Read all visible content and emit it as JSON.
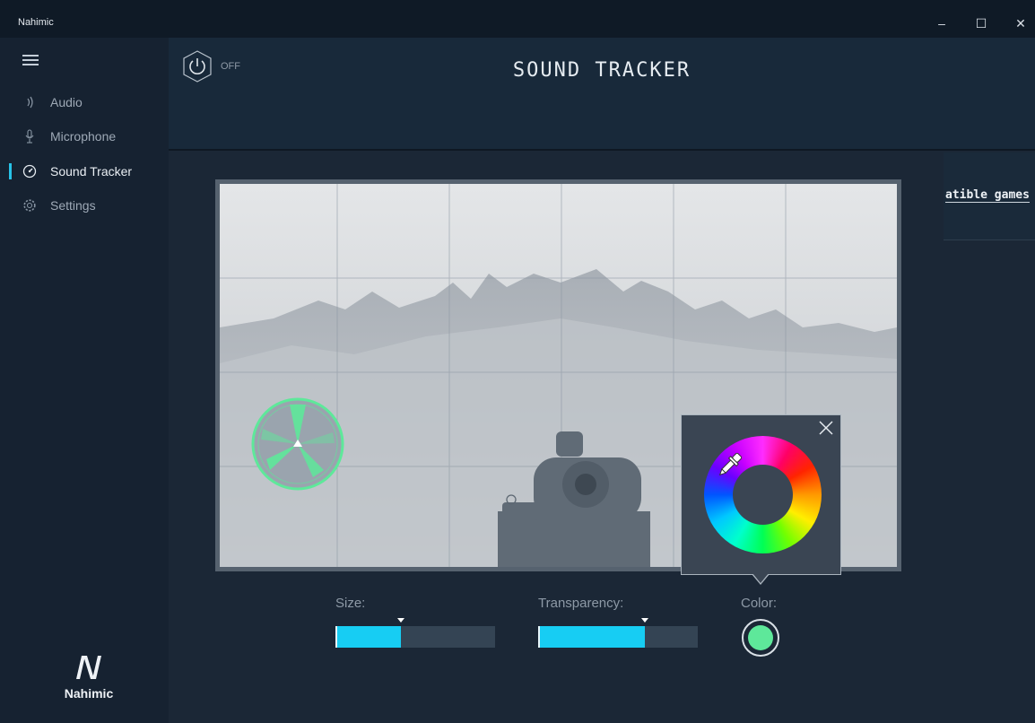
{
  "app": {
    "title": "Nahimic",
    "window_controls": {
      "minimize": "–",
      "maximize": "☐",
      "close": "✕"
    }
  },
  "sidebar": {
    "items": [
      {
        "label": "Audio",
        "icon": "audio-wave-icon",
        "active": false
      },
      {
        "label": "Microphone",
        "icon": "microphone-icon",
        "active": false
      },
      {
        "label": "Sound Tracker",
        "icon": "sound-tracker-icon",
        "active": true
      },
      {
        "label": "Settings",
        "icon": "gear-icon",
        "active": false
      }
    ],
    "logo_text": "Nahimic"
  },
  "header": {
    "title": "SOUND TRACKER",
    "power_state": "OFF"
  },
  "compatible_games_link": "atible games",
  "controls": {
    "size": {
      "label": "Size:",
      "value_fraction": 0.41
    },
    "transparency": {
      "label": "Transparency:",
      "value_fraction": 0.67
    },
    "color": {
      "label": "Color:",
      "value": "#5ee89a"
    }
  },
  "colors": {
    "accent": "#17cdf3",
    "tracker_green": "#5ee89a",
    "background": "#1b2736",
    "sidebar": "#162231"
  }
}
